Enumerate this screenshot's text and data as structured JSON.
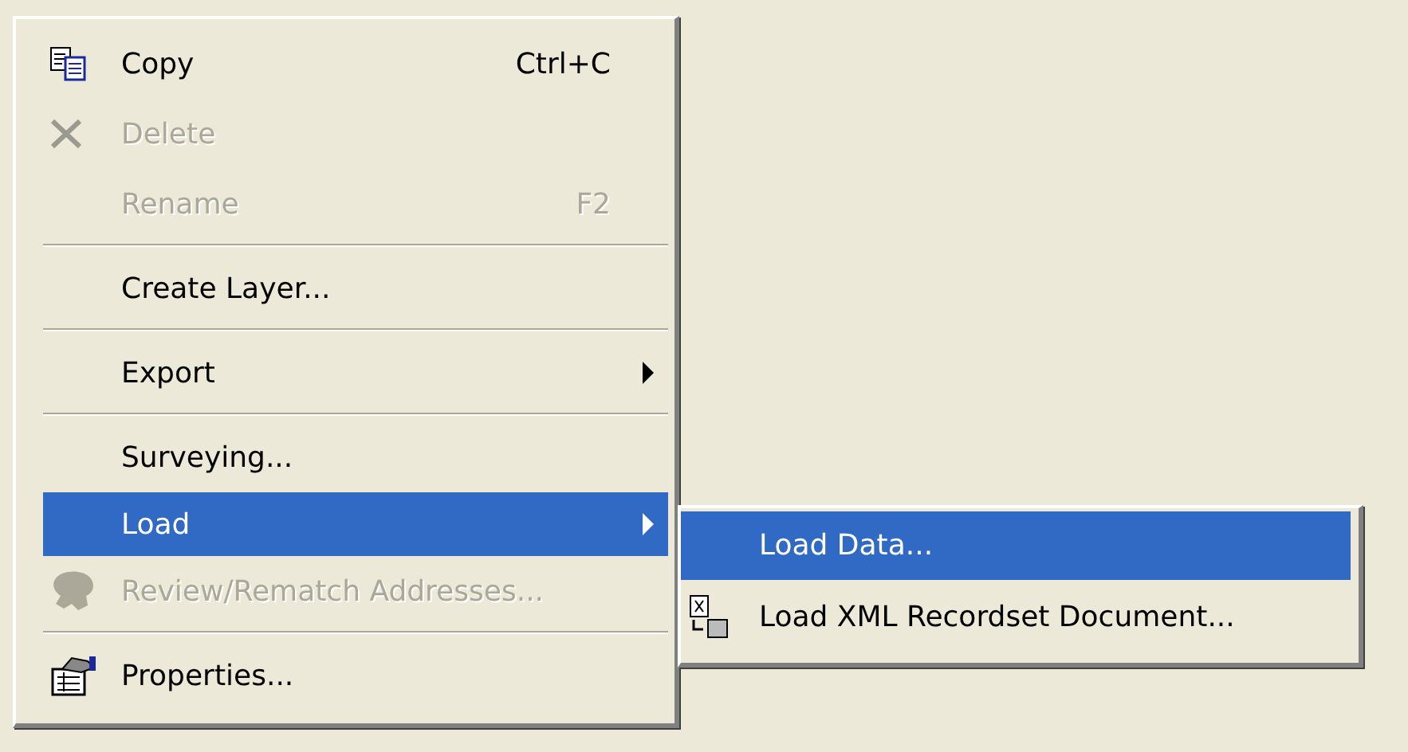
{
  "menu": {
    "items": [
      {
        "kind": "item",
        "label": "Copy",
        "shortcut": "Ctrl+C",
        "disabled": false,
        "selected": false
      },
      {
        "kind": "item",
        "label": "Delete",
        "disabled": true,
        "selected": false
      },
      {
        "kind": "item",
        "label": "Rename",
        "shortcut": "F2",
        "disabled": true,
        "selected": false
      },
      {
        "kind": "separator"
      },
      {
        "kind": "item",
        "label": "Create Layer...",
        "disabled": false,
        "selected": false
      },
      {
        "kind": "separator"
      },
      {
        "kind": "submenu",
        "label": "Export",
        "disabled": false,
        "selected": false
      },
      {
        "kind": "separator"
      },
      {
        "kind": "item",
        "label": "Surveying...",
        "disabled": false,
        "selected": false
      },
      {
        "kind": "submenu",
        "label": "Load",
        "disabled": false,
        "selected": true,
        "children": [
          {
            "kind": "item",
            "label": "Load Data...",
            "disabled": false,
            "selected": true
          },
          {
            "kind": "item",
            "label": "Load XML Recordset Document...",
            "disabled": false,
            "selected": false
          }
        ]
      },
      {
        "kind": "item",
        "label": "Review/Rematch Addresses...",
        "disabled": true,
        "selected": false
      },
      {
        "kind": "separator"
      },
      {
        "kind": "item",
        "label": "Properties...",
        "disabled": false,
        "selected": false
      }
    ]
  }
}
